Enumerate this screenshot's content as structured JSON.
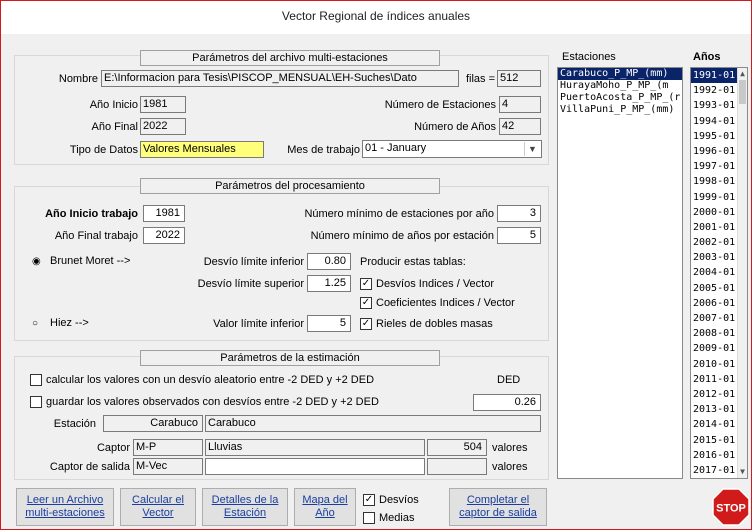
{
  "window": {
    "title": "Vector Regional de índices anuales"
  },
  "archivo": {
    "section_title": "Parámetros del archivo multi-estaciones",
    "nombre_label": "Nombre",
    "nombre_value": "E:\\Informacion para Tesis\\PISCOP_MENSUAL\\EH-Suches\\Dato",
    "filas_label": "filas =",
    "filas_value": "512",
    "anio_inicio_label": "Año Inicio",
    "anio_inicio_value": "1981",
    "num_estaciones_label": "Número de Estaciones",
    "num_estaciones_value": "4",
    "anio_final_label": "Año Final",
    "anio_final_value": "2022",
    "num_anios_label": "Número de Años",
    "num_anios_value": "42",
    "tipo_label": "Tipo de Datos",
    "tipo_value": "Valores Mensuales",
    "mes_label": "Mes de trabajo",
    "mes_value": "01 - January"
  },
  "procesamiento": {
    "section_title": "Parámetros del procesamiento",
    "inicio_label": "Año Inicio trabajo",
    "inicio_value": "1981",
    "final_label": "Año Final trabajo",
    "final_value": "2022",
    "min_est_label": "Número mínimo de estaciones por año",
    "min_est_value": "3",
    "min_anios_label": "Número mínimo de años por estación",
    "min_anios_value": "5",
    "brunet_label": "Brunet Moret -->",
    "hiez_label": "Hiez -->",
    "desv_inf_label": "Desvío límite inferior",
    "desv_inf_value": "0.80",
    "desv_sup_label": "Desvío límite superior",
    "desv_sup_value": "1.25",
    "val_lim_label": "Valor límite inferior",
    "val_lim_value": "5",
    "producir_label": "Producir estas tablas:",
    "tabla1": "Desvíos Indices / Vector",
    "tabla2": "Coeficientes Indices / Vector",
    "tabla3": "Rieles de dobles masas"
  },
  "estimacion": {
    "section_title": "Parámetros de la estimación",
    "calc_label": "calcular los valores con un desvío aleatorio entre -2 DED y +2 DED",
    "guardar_label": "guardar los valores observados con desvíos entre -2 DED y +2 DED",
    "ded_label": "DED",
    "ded_value": "0.26",
    "estacion_label": "Estación",
    "estacion_code": "Carabuco",
    "estacion_name": "Carabuco",
    "captor_label": "Captor",
    "captor_code": "M-P",
    "captor_name": "Lluvias",
    "captor_count": "504",
    "valores_label": "valores",
    "captor_salida_label": "Captor de salida",
    "captor_salida_code": "M-Vec",
    "captor_salida_name": "",
    "captor_salida_count": "",
    "valores2_label": "valores"
  },
  "estaciones": {
    "header": "Estaciones",
    "items": [
      "Carabuco_P_MP_(mm)",
      "HurayaMoho_P_MP_(m",
      "PuertoAcosta_P_MP_(r",
      "VillaPuni_P_MP_(mm)"
    ]
  },
  "anios": {
    "header": "Años",
    "items": [
      "1991-01",
      "1992-01",
      "1993-01",
      "1994-01",
      "1995-01",
      "1996-01",
      "1997-01",
      "1998-01",
      "1999-01",
      "2000-01",
      "2001-01",
      "2002-01",
      "2003-01",
      "2004-01",
      "2005-01",
      "2006-01",
      "2007-01",
      "2008-01",
      "2009-01",
      "2010-01",
      "2011-01",
      "2012-01",
      "2013-01",
      "2014-01",
      "2015-01",
      "2016-01",
      "2017-01"
    ]
  },
  "buttons": {
    "leer": "Leer un Archivo multi-estaciones",
    "calcular": "Calcular el Vector",
    "detalles": "Detalles de la Estación",
    "mapa": "Mapa del Año",
    "desvios": "Desvíos",
    "medias": "Medias",
    "completar": "Completar el captor de salida",
    "stop": "STOP"
  },
  "colors": {
    "accent": "#d11a1a",
    "selection": "#0a246a",
    "highlight": "#ffff7a"
  }
}
